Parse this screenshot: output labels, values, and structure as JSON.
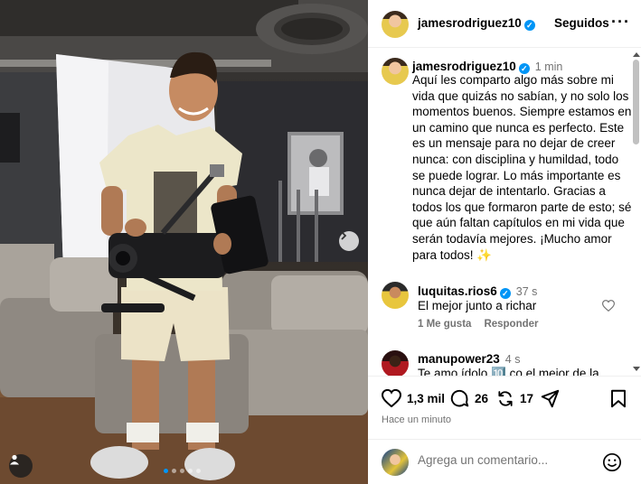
{
  "post": {
    "author": "jamesrodriguez10",
    "follow_status": "Seguidos",
    "more_label": "···",
    "caption_time": "1 min",
    "caption": "Aquí les comparto algo más sobre mi vida que quizás no sabían, y no solo los momentos buenos. Siempre estamos en un camino que nunca es perfecto. Este es un mensaje para no dejar de creer nunca: con disciplina y humildad, todo se puede lograr. Lo más importante es nunca dejar de intentarlo. Gracias a todos los que formaron parte de esto; sé que aún faltan capítulos en mi vida que serán todavía mejores. ¡Mucho amor para todos! ✨",
    "likes": "1,3 mil",
    "comments_count": "26",
    "reposts": "17",
    "posted_ago": "Hace un minuto"
  },
  "comments": [
    {
      "user": "luquitas.rios6",
      "verified": true,
      "time": "37 s",
      "text": "El mejor junto a richar",
      "likes_label": "1 Me gusta",
      "reply_label": "Responder"
    },
    {
      "user": "manupower23",
      "verified": false,
      "time": "4 s",
      "text": "Te amo ídolo 🔟 co el mejor de la"
    }
  ],
  "composer": {
    "placeholder": "Agrega un comentario..."
  },
  "carousel": {
    "total": 5,
    "current": 1
  },
  "icons": [
    "verified-badge-icon",
    "more-options-icon",
    "heart-icon",
    "comment-icon",
    "repost-icon",
    "share-icon",
    "bookmark-icon",
    "emoji-icon",
    "user-tag-icon",
    "chevron-right-icon"
  ],
  "colors": {
    "accent": "#0095f6",
    "muted": "#737373",
    "border": "#efefef"
  }
}
